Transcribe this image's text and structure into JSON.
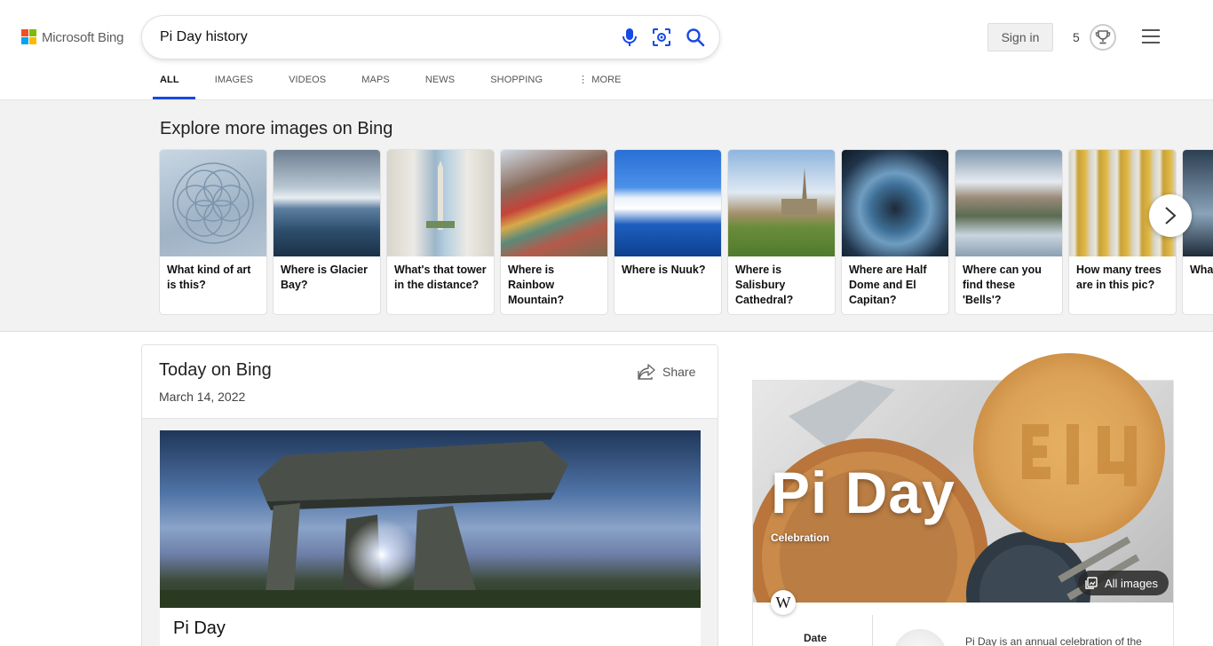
{
  "header": {
    "logo_text": "Microsoft Bing",
    "search_value": "Pi Day history",
    "signin_label": "Sign in",
    "rewards_count": "5",
    "tabs": [
      {
        "label": "ALL",
        "active": true
      },
      {
        "label": "IMAGES"
      },
      {
        "label": "VIDEOS"
      },
      {
        "label": "MAPS"
      },
      {
        "label": "NEWS"
      },
      {
        "label": "SHOPPING"
      },
      {
        "label": "MORE"
      }
    ]
  },
  "explore": {
    "title": "Explore more images on Bing",
    "cards": [
      {
        "label": "What kind of art is this?"
      },
      {
        "label": "Where is Glacier Bay?"
      },
      {
        "label": "What's that tower in the distance?"
      },
      {
        "label": "Where is Rainbow Mountain?"
      },
      {
        "label": "Where is Nuuk?"
      },
      {
        "label": "Where is Salisbury Cathedral?"
      },
      {
        "label": "Where are Half Dome and El Capitan?"
      },
      {
        "label": "Where can you find these 'Bells'?"
      },
      {
        "label": "How many trees are in this pic?"
      },
      {
        "label": "What fanta form"
      }
    ]
  },
  "today": {
    "title": "Today on Bing",
    "date": "March 14, 2022",
    "share_label": "Share",
    "card_title": "Pi Day"
  },
  "knowledge_panel": {
    "title": "Pi Day",
    "subtitle": "Celebration",
    "all_images_label": "All images",
    "wiki_letter": "W",
    "date_label": "Date",
    "description": "Pi Day is an annual celebration of the"
  },
  "colors": {
    "brand_red": "#f25022",
    "brand_green": "#7fba00",
    "brand_blue": "#00a4ef",
    "brand_yellow": "#ffb900",
    "accent": "#174ae4"
  }
}
